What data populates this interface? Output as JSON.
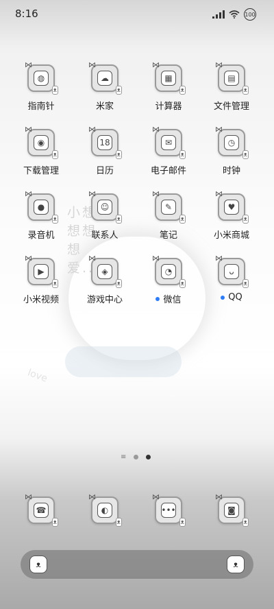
{
  "status": {
    "time": "8:16",
    "battery": "100"
  },
  "wallpaper": {
    "text": "小想想想想爱...",
    "love": "love"
  },
  "apps": [
    {
      "label": "指南针",
      "icon": "compass-icon",
      "glyph": "◍"
    },
    {
      "label": "米家",
      "icon": "mijia-icon",
      "glyph": "☁"
    },
    {
      "label": "计算器",
      "icon": "calculator-icon",
      "glyph": "▦"
    },
    {
      "label": "文件管理",
      "icon": "file-manager-icon",
      "glyph": "▤"
    },
    {
      "label": "下载管理",
      "icon": "download-manager-icon",
      "glyph": "◉"
    },
    {
      "label": "日历",
      "icon": "calendar-icon",
      "glyph": "18"
    },
    {
      "label": "电子邮件",
      "icon": "email-icon",
      "glyph": "✉"
    },
    {
      "label": "时钟",
      "icon": "clock-icon",
      "glyph": "◷"
    },
    {
      "label": "录音机",
      "icon": "recorder-icon",
      "glyph": "●"
    },
    {
      "label": "联系人",
      "icon": "contacts-icon",
      "glyph": "☺"
    },
    {
      "label": "笔记",
      "icon": "notes-icon",
      "glyph": "✎"
    },
    {
      "label": "小米商城",
      "icon": "mi-store-icon",
      "glyph": "♥"
    },
    {
      "label": "小米视频",
      "icon": "mi-video-icon",
      "glyph": "▶"
    },
    {
      "label": "游戏中心",
      "icon": "game-center-icon",
      "glyph": "◈"
    },
    {
      "label": "微信",
      "icon": "wechat-icon",
      "glyph": "◔",
      "badge": true
    },
    {
      "label": "QQ",
      "icon": "qq-icon",
      "glyph": "ᴗ",
      "badge": true
    }
  ],
  "dock": [
    {
      "name": "phone",
      "icon": "phone-icon",
      "glyph": "☎"
    },
    {
      "name": "browser",
      "icon": "browser-icon",
      "glyph": "◐"
    },
    {
      "name": "messages",
      "icon": "messages-icon",
      "glyph": "•••"
    },
    {
      "name": "camera",
      "icon": "camera-icon",
      "glyph": "◙"
    }
  ],
  "pager": {
    "pages": 2,
    "current": 2
  },
  "colors": {
    "badge": "#2d7cf6",
    "pager_active": "#333333",
    "pager_inactive": "#9a9a9a"
  }
}
